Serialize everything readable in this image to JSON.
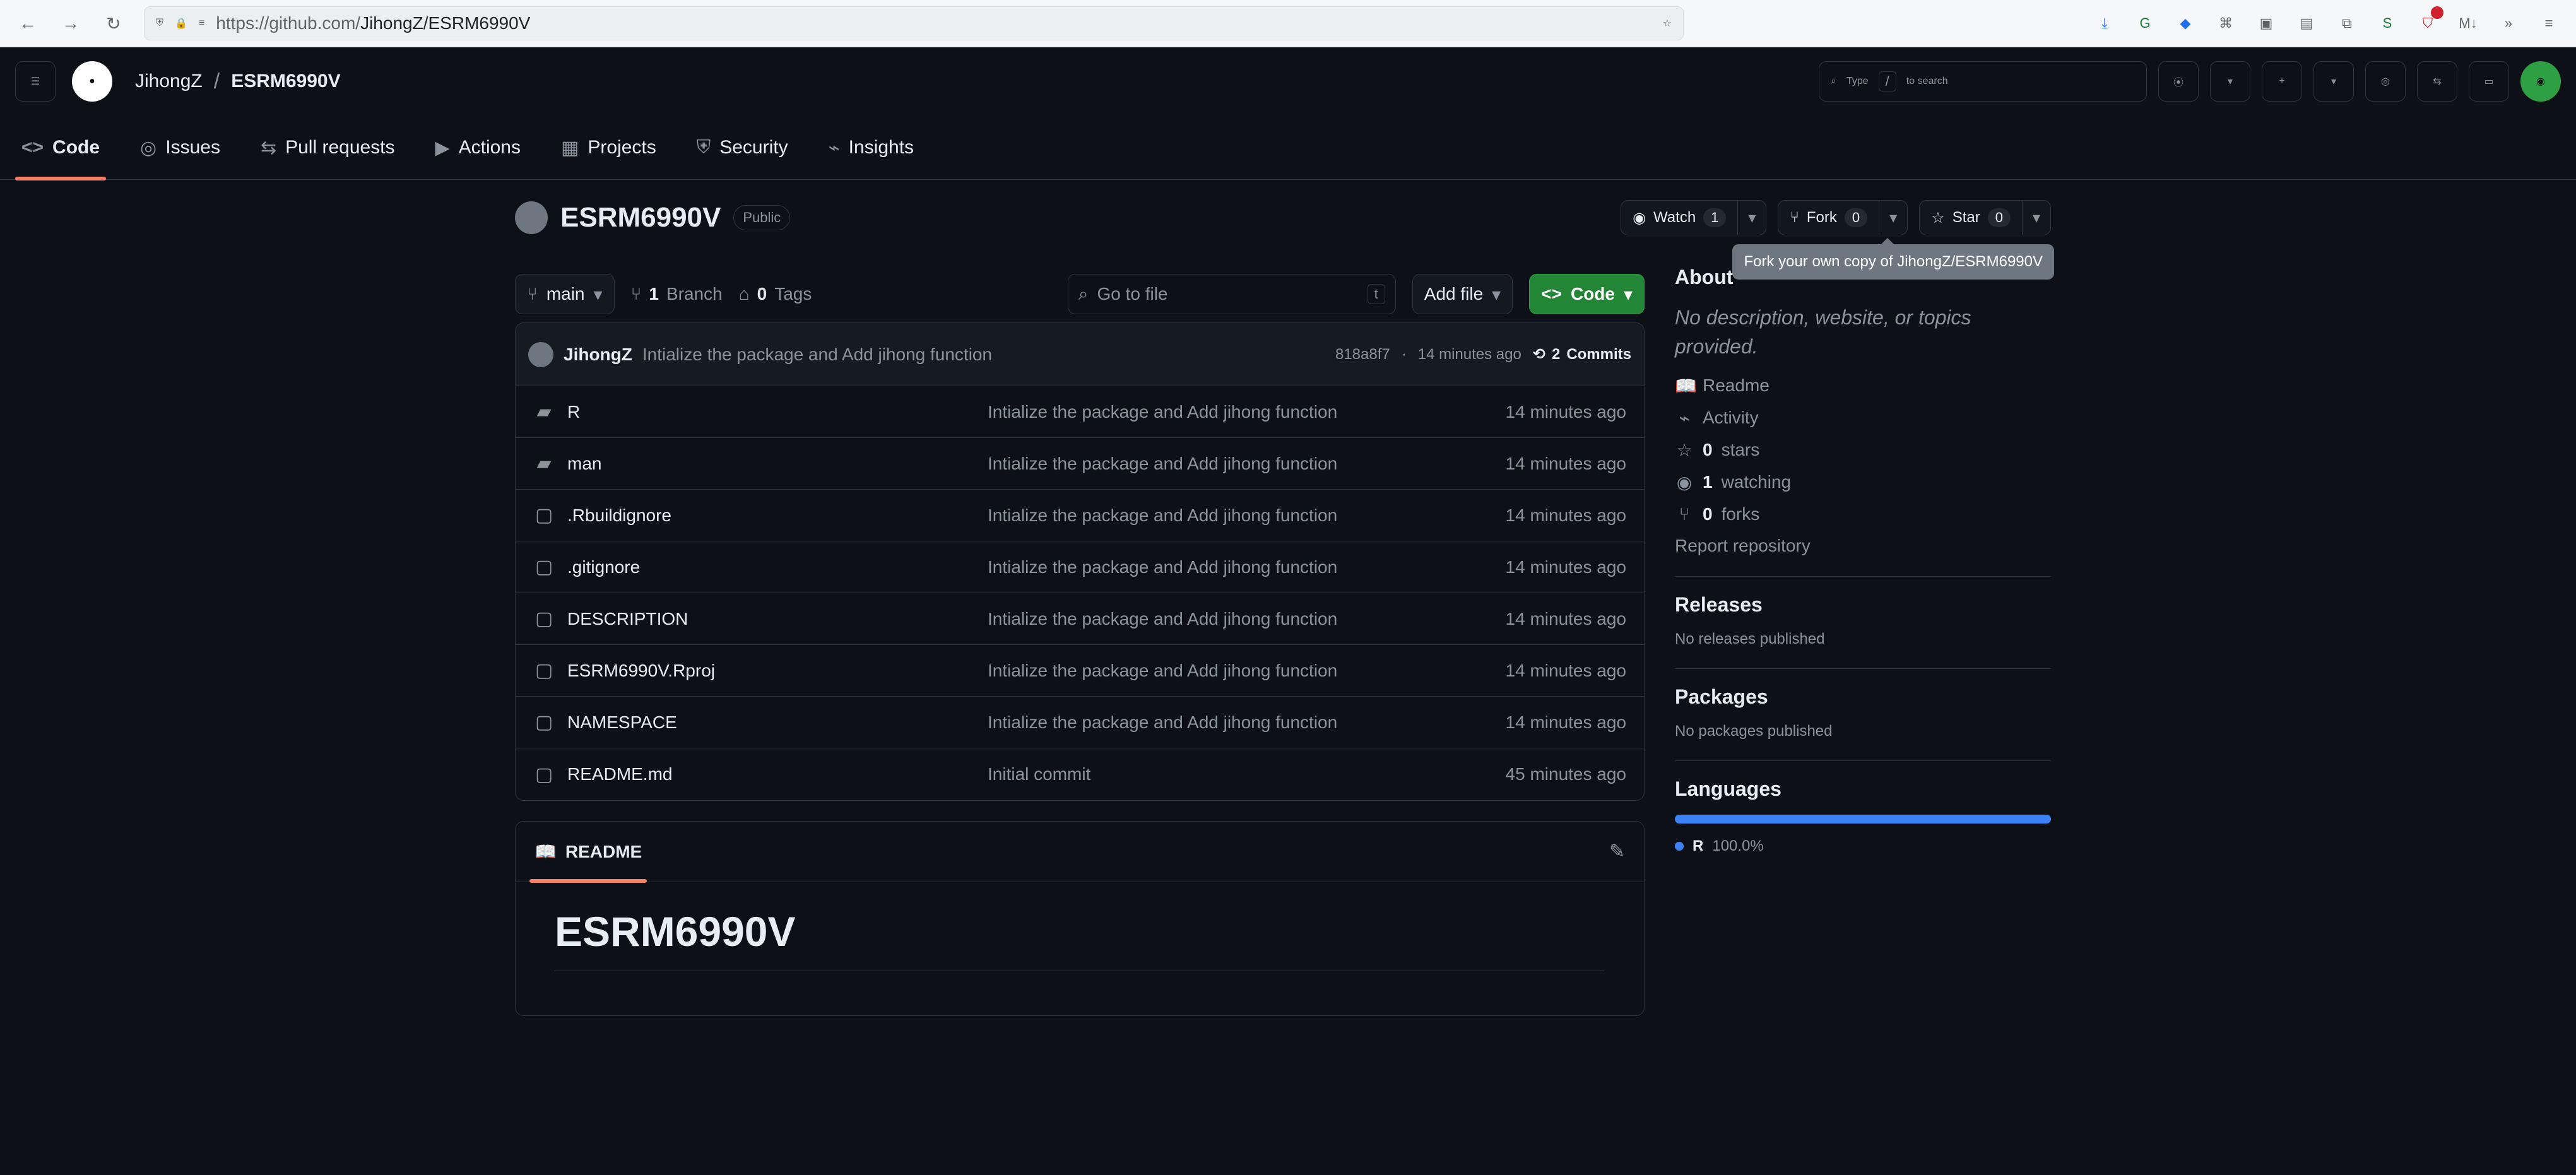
{
  "browser": {
    "url_prefix": "https://github.com/",
    "url_path": "JihongZ/ESRM6990V",
    "url_full": "https://github.com/JihongZ/ESRM6990V"
  },
  "header": {
    "owner": "JihongZ",
    "repo": "ESRM6990V",
    "search_placeholder_left": "Type",
    "search_shortcut": "/",
    "search_placeholder_right": "to search"
  },
  "tabs": [
    {
      "label": "Code",
      "icon": "code-icon",
      "active": true
    },
    {
      "label": "Issues",
      "icon": "issue-icon",
      "active": false
    },
    {
      "label": "Pull requests",
      "icon": "pull-request-icon",
      "active": false
    },
    {
      "label": "Actions",
      "icon": "play-icon",
      "active": false
    },
    {
      "label": "Projects",
      "icon": "table-icon",
      "active": false
    },
    {
      "label": "Security",
      "icon": "shield-icon",
      "active": false
    },
    {
      "label": "Insights",
      "icon": "graph-icon",
      "active": false
    }
  ],
  "repo_header": {
    "name": "ESRM6990V",
    "visibility": "Public",
    "watch_label": "Watch",
    "watch_count": "1",
    "fork_label": "Fork",
    "fork_count": "0",
    "star_label": "Star",
    "star_count": "0",
    "tooltip": "Fork your own copy of JihongZ/ESRM6990V"
  },
  "controls": {
    "branch": "main",
    "branches_count": "1",
    "branches_label": "Branch",
    "tags_count": "0",
    "tags_label": "Tags",
    "goto_placeholder": "Go to file",
    "goto_shortcut": "t",
    "add_file": "Add file",
    "code": "Code"
  },
  "latest_commit": {
    "user": "JihongZ",
    "message": "Intialize the package and Add jihong function",
    "hash": "818a8f7",
    "time": "14 minutes ago",
    "commits_count": "2",
    "commits_label": "Commits"
  },
  "files": [
    {
      "name": "R",
      "type": "dir",
      "message": "Intialize the package and Add jihong function",
      "time": "14 minutes ago"
    },
    {
      "name": "man",
      "type": "dir",
      "message": "Intialize the package and Add jihong function",
      "time": "14 minutes ago"
    },
    {
      "name": ".Rbuildignore",
      "type": "file",
      "message": "Intialize the package and Add jihong function",
      "time": "14 minutes ago"
    },
    {
      "name": ".gitignore",
      "type": "file",
      "message": "Intialize the package and Add jihong function",
      "time": "14 minutes ago"
    },
    {
      "name": "DESCRIPTION",
      "type": "file",
      "message": "Intialize the package and Add jihong function",
      "time": "14 minutes ago"
    },
    {
      "name": "ESRM6990V.Rproj",
      "type": "file",
      "message": "Intialize the package and Add jihong function",
      "time": "14 minutes ago"
    },
    {
      "name": "NAMESPACE",
      "type": "file",
      "message": "Intialize the package and Add jihong function",
      "time": "14 minutes ago"
    },
    {
      "name": "README.md",
      "type": "file",
      "message": "Initial commit",
      "time": "45 minutes ago"
    }
  ],
  "readme": {
    "tab_label": "README",
    "title": "ESRM6990V"
  },
  "about": {
    "title": "About",
    "description": "No description, website, or topics provided.",
    "readme": "Readme",
    "activity": "Activity",
    "stars_count": "0",
    "stars_label": "stars",
    "watching_count": "1",
    "watching_label": "watching",
    "forks_count": "0",
    "forks_label": "forks",
    "report": "Report repository"
  },
  "releases": {
    "title": "Releases",
    "text": "No releases published"
  },
  "packages": {
    "title": "Packages",
    "text": "No packages published"
  },
  "languages": {
    "title": "Languages",
    "name": "R",
    "percent": "100.0%",
    "color": "#3b82f6"
  }
}
